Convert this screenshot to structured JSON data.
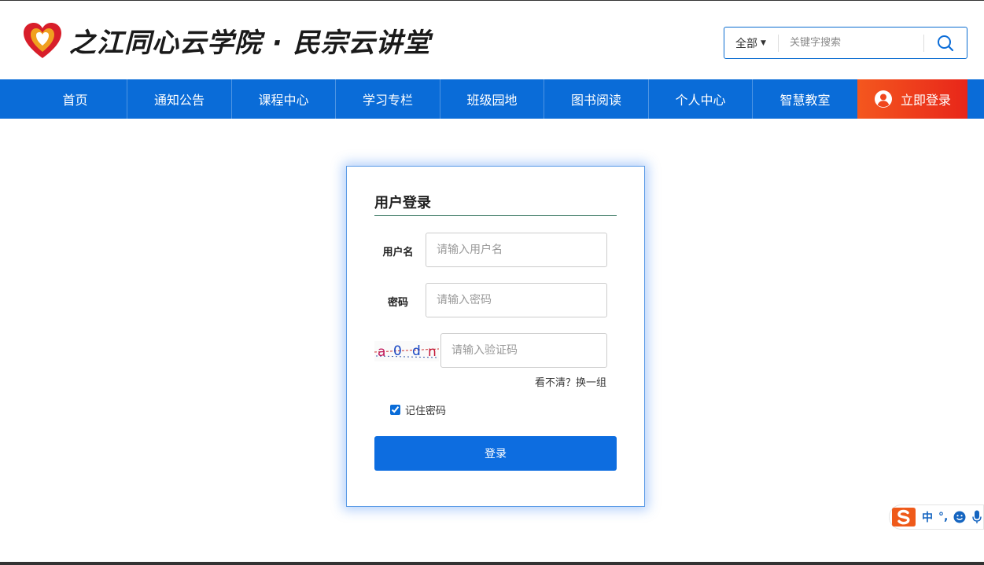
{
  "site": {
    "title": "之江同心云学院 · 民宗云讲堂",
    "brand_colors": {
      "primary": "#0a6cd8",
      "login_accent": "#e8261a",
      "logo_red": "#d81e2a",
      "logo_gold": "#f0a020"
    }
  },
  "search": {
    "category": "全部",
    "placeholder": "关键字搜索",
    "icon": "search-icon"
  },
  "nav": {
    "items": [
      {
        "label": "首页"
      },
      {
        "label": "通知公告"
      },
      {
        "label": "课程中心"
      },
      {
        "label": "学习专栏"
      },
      {
        "label": "班级园地"
      },
      {
        "label": "图书阅读"
      },
      {
        "label": "个人中心"
      },
      {
        "label": "智慧教室"
      }
    ],
    "login_label": "立即登录",
    "login_icon": "user-icon"
  },
  "login": {
    "title": "用户登录",
    "username_label": "用户名",
    "username_placeholder": "请输入用户名",
    "password_label": "密码",
    "password_placeholder": "请输入密码",
    "captcha_text": "a0dn",
    "captcha_placeholder": "请输入验证码",
    "refresh_text": "看不清？换一组",
    "remember_label": "记住密码",
    "remember_checked": true,
    "submit_label": "登录"
  },
  "ime": {
    "mode": "中",
    "punct": "°,",
    "icons": [
      "sogou-logo-icon",
      "emoji-icon",
      "microphone-icon"
    ]
  }
}
